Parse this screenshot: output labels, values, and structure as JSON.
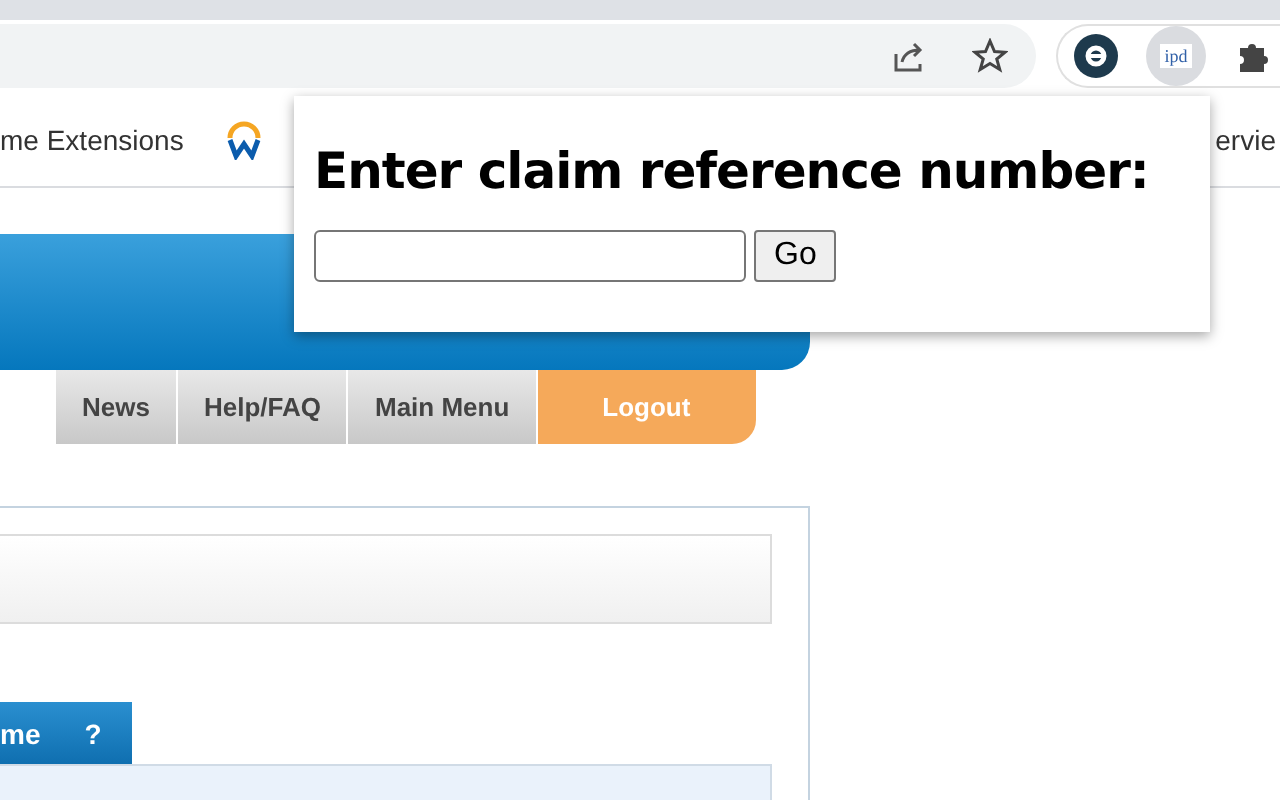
{
  "bookmarks": [
    {
      "label": "me Extensions",
      "kind": "text"
    },
    {
      "kind": "workday"
    },
    {
      "label": "ervie",
      "kind": "text"
    }
  ],
  "nav": [
    {
      "label": "News",
      "selected": false
    },
    {
      "label": "Help/FAQ",
      "selected": false
    },
    {
      "label": "Main Menu",
      "selected": false
    },
    {
      "label": "Logout",
      "selected": true
    }
  ],
  "tab": {
    "label": "me",
    "help": "?"
  },
  "popup": {
    "title": "Enter claim reference number:",
    "button": "Go"
  },
  "extension_icon": {
    "label": "ipd"
  }
}
